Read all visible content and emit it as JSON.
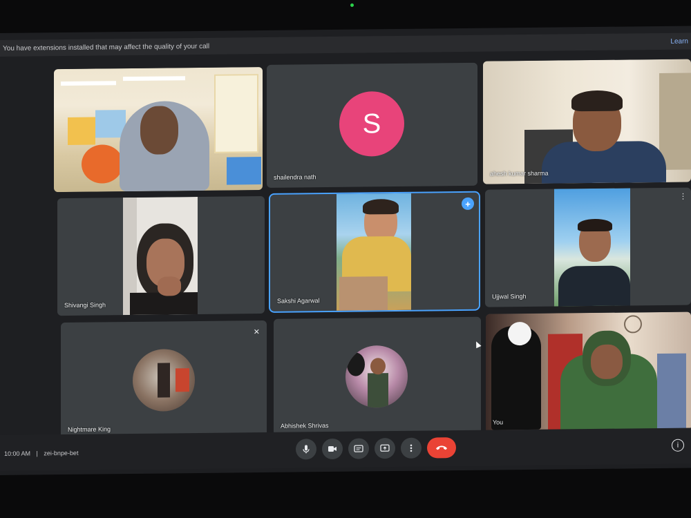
{
  "banner": {
    "text": "You have extensions installed that may affect the quality of your call",
    "link": "Learn"
  },
  "participants": [
    {
      "name": "",
      "kind": "video"
    },
    {
      "name": "shailendra nath",
      "kind": "avatar",
      "initial": "S"
    },
    {
      "name": "ahesh kumar sharma",
      "kind": "video"
    },
    {
      "name": "Shivangi Singh",
      "kind": "video"
    },
    {
      "name": "Sakshi Agarwal",
      "kind": "video"
    },
    {
      "name": "Ujjwal Singh",
      "kind": "video"
    },
    {
      "name": "Nightmare King",
      "kind": "photo-avatar"
    },
    {
      "name": "Abhishek Shrivas",
      "kind": "photo-avatar"
    },
    {
      "name": "You",
      "kind": "video"
    }
  ],
  "meeting": {
    "time": "10:00 AM",
    "separator": "|",
    "code": "zei-bnpe-bet"
  },
  "controls": {
    "mic": "microphone-icon",
    "camera": "camera-icon",
    "captions": "captions-icon",
    "present": "present-icon",
    "more": "more-options-icon",
    "end": "end-call-icon"
  },
  "colors": {
    "accent": "#4aa3ff",
    "end_call": "#ea4335",
    "avatar_pink": "#e8447a"
  }
}
